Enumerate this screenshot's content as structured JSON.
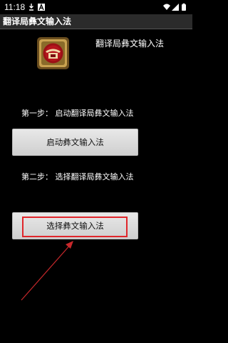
{
  "status_bar": {
    "time": "11:18",
    "icons": [
      "download-icon",
      "a-notification-icon",
      "wifi-icon",
      "signal-icon",
      "battery-icon"
    ]
  },
  "title_bar": {
    "title": "翻译局彝文输入法"
  },
  "header": {
    "app_name": "翻译局彝文输入法"
  },
  "step1": {
    "label": "第一步：  启动翻译局彝文输入法",
    "button": "启动彝文输入法"
  },
  "step2": {
    "label": "第二步：  选择翻译局彝文输入法",
    "button": "选择彝文输入法"
  },
  "colors": {
    "background": "#000000",
    "title_bar": "#2b2b2b",
    "button": "#dcdcdc",
    "highlight": "#e0262b"
  }
}
